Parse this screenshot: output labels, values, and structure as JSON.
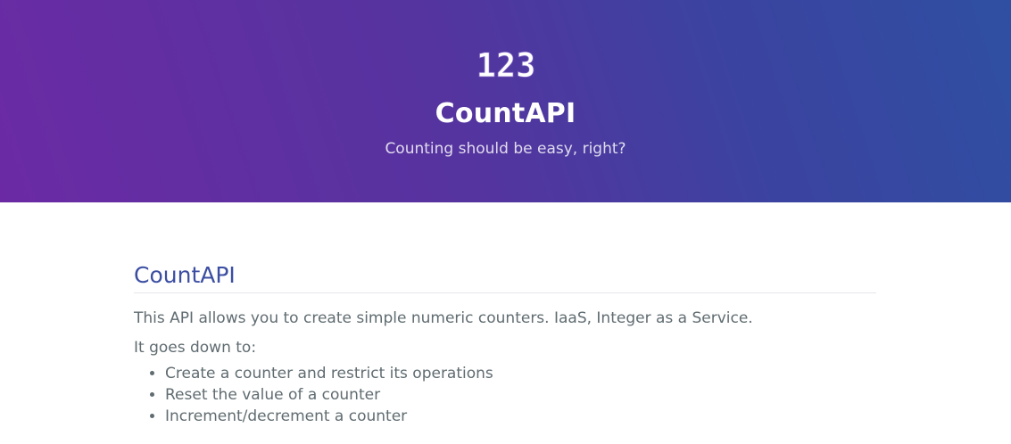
{
  "header": {
    "logo_icon": "counter-123-logo-icon",
    "logo_text": "123",
    "title": "CountAPI",
    "tagline": "Counting should be easy, right?"
  },
  "main": {
    "heading": "CountAPI",
    "intro": "This API allows you to create simple numeric counters. IaaS, Integer as a Service.",
    "list_intro": "It goes down to:",
    "features": [
      "Create a counter and restrict its operations",
      "Reset the value of a counter",
      "Increment/decrement a counter"
    ]
  },
  "colors": {
    "hero_gradient_start": "#6b2aa4",
    "hero_gradient_end": "#2f4fa2",
    "heading": "#3b4ea2",
    "body_text": "#606c71"
  }
}
